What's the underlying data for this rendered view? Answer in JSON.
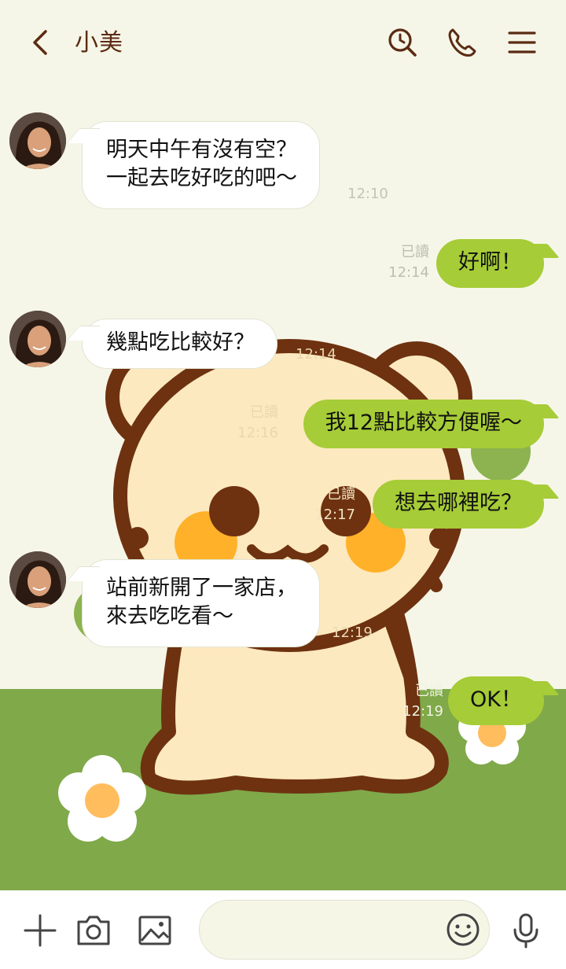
{
  "header": {
    "title": "小美",
    "icons": [
      "back-chevron-icon",
      "search-clock-icon",
      "phone-icon",
      "menu-icon"
    ]
  },
  "messages": [
    {
      "side": "in",
      "text": "明天中午有沒有空？\n一起去吃好吃的吧～",
      "time": "12:10"
    },
    {
      "side": "out",
      "text": "好啊！",
      "read": "已讀",
      "time": "12:14"
    },
    {
      "side": "in",
      "text": "幾點吃比較好？",
      "time": "12:14"
    },
    {
      "side": "out",
      "text": "我12點比較方便喔～",
      "read": "已讀",
      "time": "12:16"
    },
    {
      "side": "out",
      "text": "想去哪裡吃？",
      "read": "已讀",
      "time": "12:17"
    },
    {
      "side": "in",
      "text": "站前新開了一家店，\n來去吃吃看～",
      "time": "12:19"
    },
    {
      "side": "out",
      "text": "OK！",
      "read": "已讀",
      "time": "12:19"
    }
  ],
  "input_bar": {
    "placeholder": "",
    "icons": [
      "plus-icon",
      "camera-icon",
      "image-icon",
      "emoji-icon",
      "microphone-icon"
    ]
  },
  "colors": {
    "accent_brown": "#5b2b13",
    "outgoing_bubble": "#a6cc37",
    "background_cream": "#f6f6e8",
    "grass": "#80a94a"
  }
}
